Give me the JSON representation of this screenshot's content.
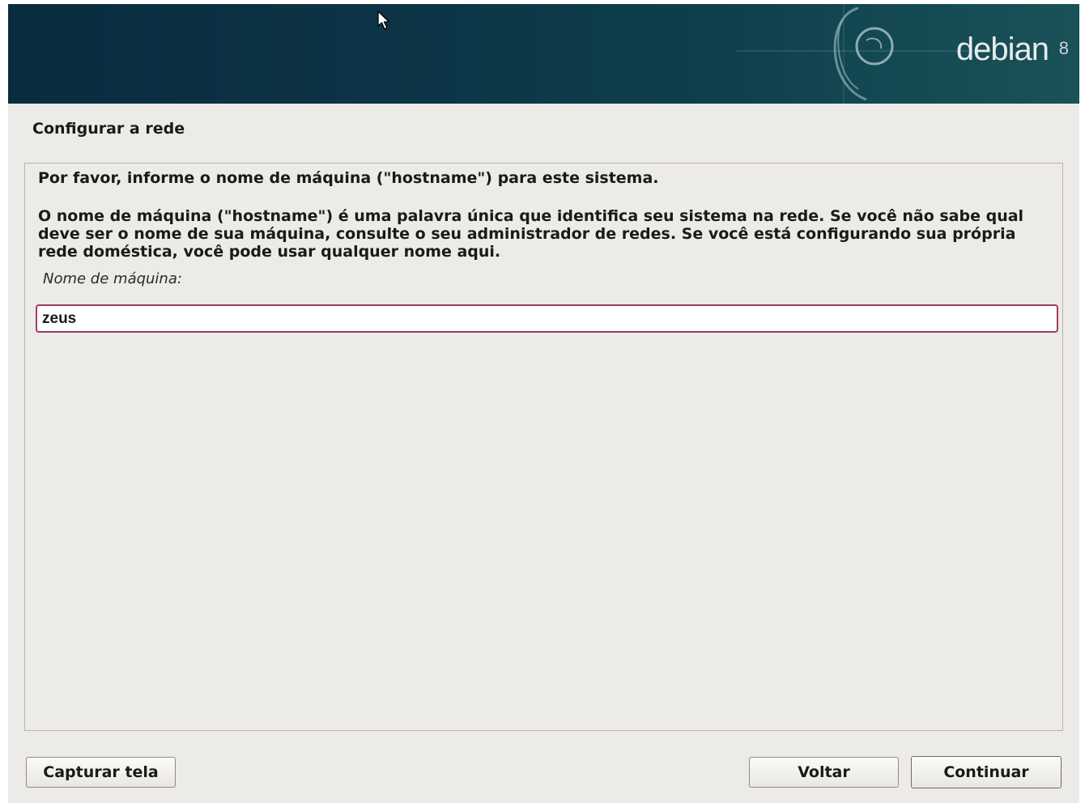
{
  "banner": {
    "logo_text": "debian",
    "version": "8"
  },
  "page": {
    "title": "Configurar a rede"
  },
  "content": {
    "prompt": "Por favor, informe o nome de máquina (\"hostname\") para este sistema.",
    "description": "O nome de máquina (\"hostname\") é uma palavra única que identifica seu sistema na rede. Se você não sabe qual deve ser o nome de sua máquina, consulte o seu administrador de redes. Se você está configurando sua própria rede doméstica, você pode usar qualquer nome aqui.",
    "field_label": "Nome de máquina:",
    "field_value": "zeus"
  },
  "buttons": {
    "screenshot": "Capturar tela",
    "back": "Voltar",
    "continue": "Continuar"
  },
  "colors": {
    "banner_dark": "#0a2c3f",
    "input_focus_border": "#a13c63",
    "background": "#edebe7"
  },
  "icons": {
    "banner_swirl": "debian-swirl-icon",
    "cursor": "mouse-pointer-icon"
  }
}
